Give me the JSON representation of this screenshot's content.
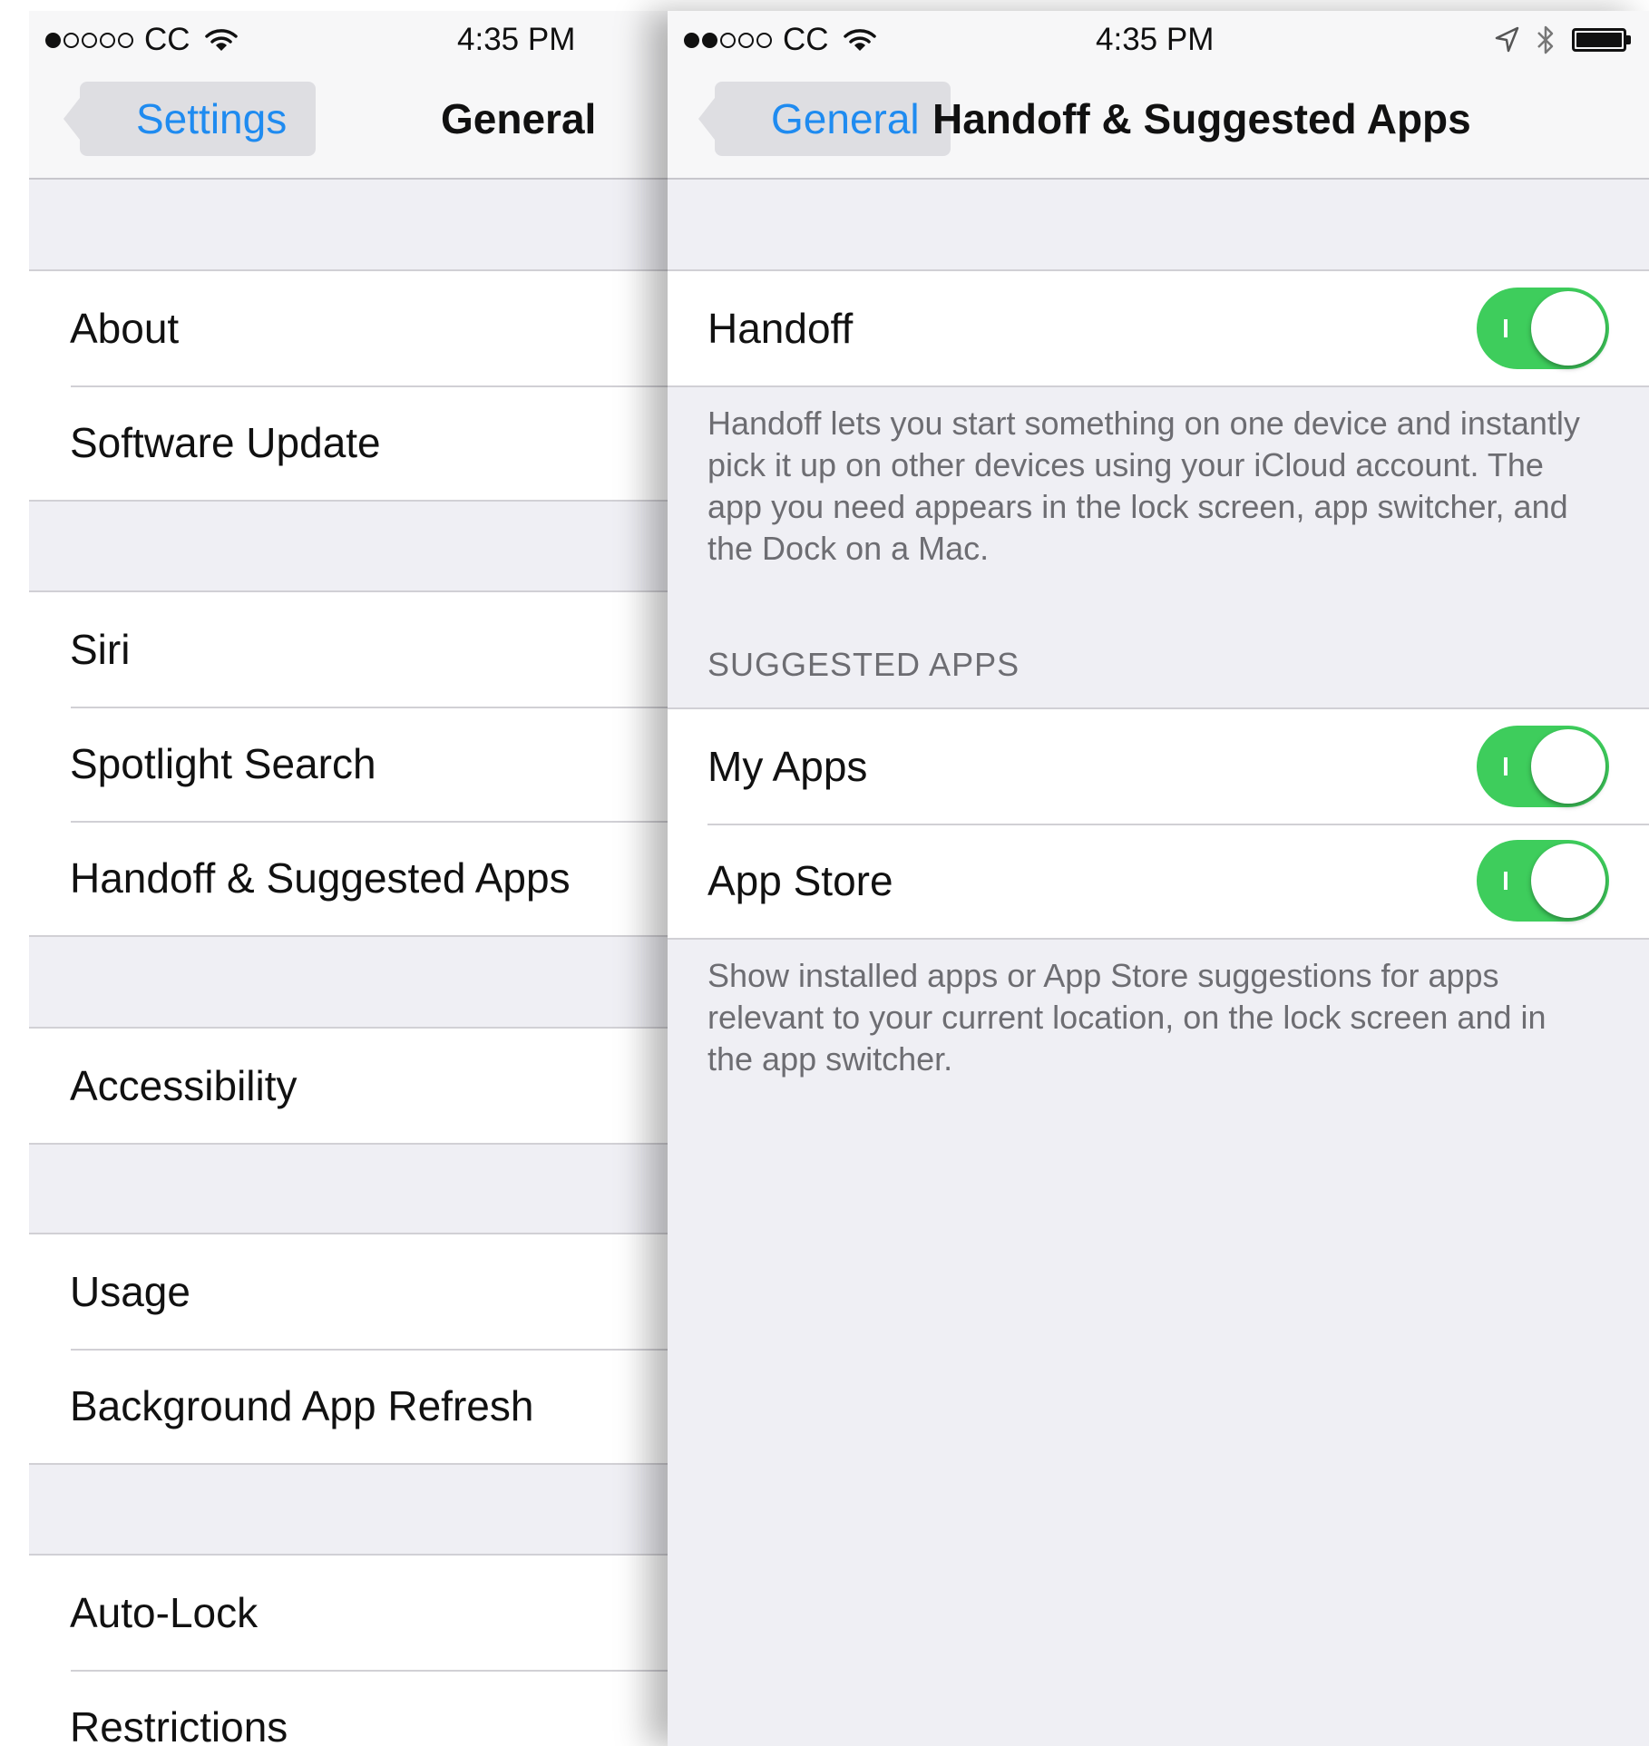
{
  "left_screen": {
    "status_bar": {
      "signal_dots": [
        true,
        false,
        false,
        false,
        false
      ],
      "carrier": "CC",
      "time": "4:35 PM"
    },
    "nav": {
      "back_label": "Settings",
      "title": "General"
    },
    "groups": [
      {
        "items": [
          "About",
          "Software Update"
        ]
      },
      {
        "items": [
          "Siri",
          "Spotlight Search",
          "Handoff & Suggested Apps"
        ]
      },
      {
        "items": [
          "Accessibility"
        ]
      },
      {
        "items": [
          "Usage",
          "Background App Refresh"
        ]
      },
      {
        "items": [
          "Auto-Lock",
          "Restrictions"
        ]
      }
    ]
  },
  "right_screen": {
    "status_bar": {
      "signal_dots": [
        true,
        true,
        false,
        false,
        false
      ],
      "carrier": "CC",
      "time": "4:35 PM",
      "icons": [
        "location-arrow-icon",
        "bluetooth-icon",
        "battery-icon"
      ]
    },
    "nav": {
      "back_label": "General",
      "title": "Handoff & Suggested Apps"
    },
    "handoff": {
      "label": "Handoff",
      "enabled": true,
      "footer": "Handoff lets you start something on one device and instantly pick it up on other devices using your iCloud account. The app you need appears in the lock screen, app switcher, and the Dock on a Mac."
    },
    "suggested_apps": {
      "header": "SUGGESTED APPS",
      "items": [
        {
          "label": "My Apps",
          "enabled": true
        },
        {
          "label": "App Store",
          "enabled": true
        }
      ],
      "footer": "Show installed apps or App Store suggestions for apps relevant to your current location, on the lock screen and in the app switcher."
    }
  },
  "colors": {
    "accent": "#1f8bf0",
    "toggle_on": "#3ecd5c",
    "background": "#efeff4"
  }
}
